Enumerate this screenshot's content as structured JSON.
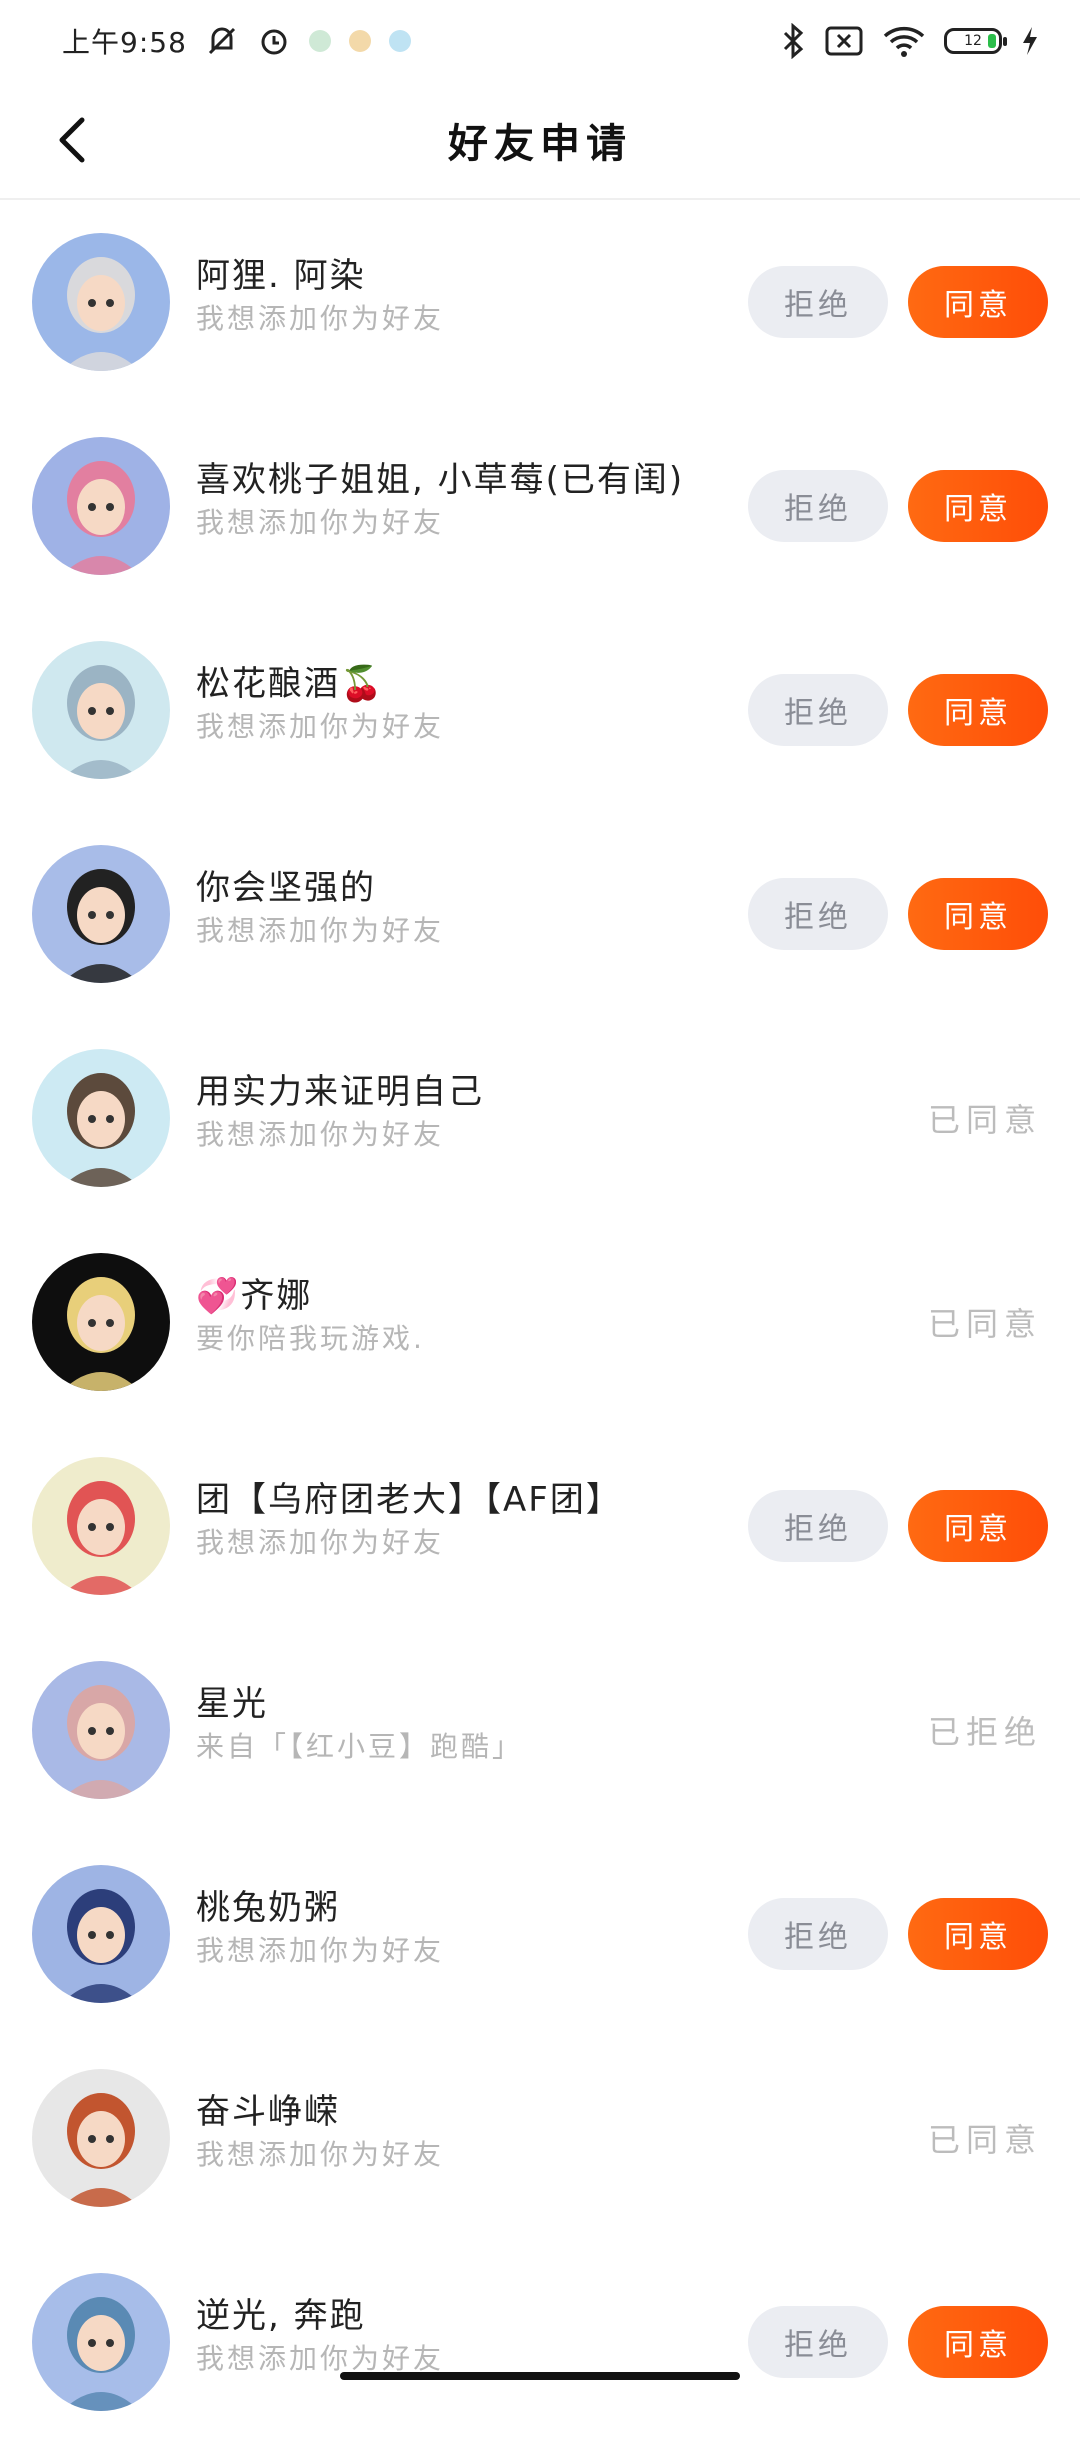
{
  "status_bar": {
    "time": "上午9:58",
    "battery_level": "12",
    "accent_green": "#2bbd4a"
  },
  "header": {
    "title": "好友申请",
    "back_icon": "chevron-left-icon"
  },
  "buttons": {
    "reject_label": "拒绝",
    "accept_label": "同意"
  },
  "colors": {
    "accept": "#ff5a0c",
    "reject_bg": "#ebedf2",
    "muted_text": "#b6b6b6"
  },
  "requests": [
    {
      "name": "阿狸. 阿染",
      "message": "我想添加你为好友",
      "state": "pending",
      "status_text": ""
    },
    {
      "name": "喜欢桃子姐姐, 小草莓(已有闺)",
      "message": "我想添加你为好友",
      "state": "pending",
      "status_text": ""
    },
    {
      "name": "松花酿酒🍒",
      "message": "我想添加你为好友",
      "state": "pending",
      "status_text": ""
    },
    {
      "name": "你会坚强的",
      "message": "我想添加你为好友",
      "state": "pending",
      "status_text": ""
    },
    {
      "name": "用实力来证明自己",
      "message": "我想添加你为好友",
      "state": "done",
      "status_text": "已同意"
    },
    {
      "name": "💞齐娜",
      "message": "要你陪我玩游戏.",
      "state": "done",
      "status_text": "已同意"
    },
    {
      "name": "团【乌府团老大】【AF团】",
      "message": "我想添加你为好友",
      "state": "pending",
      "status_text": ""
    },
    {
      "name": "星光",
      "message": "来自「【红小豆】跑酷」",
      "state": "done",
      "status_text": "已拒绝"
    },
    {
      "name": "桃兔奶粥",
      "message": "我想添加你为好友",
      "state": "pending",
      "status_text": ""
    },
    {
      "name": "奋斗峥嵘",
      "message": "我想添加你为好友",
      "state": "done",
      "status_text": "已同意"
    },
    {
      "name": "逆光, 奔跑",
      "message": "我想添加你为好友",
      "state": "pending",
      "status_text": ""
    }
  ]
}
